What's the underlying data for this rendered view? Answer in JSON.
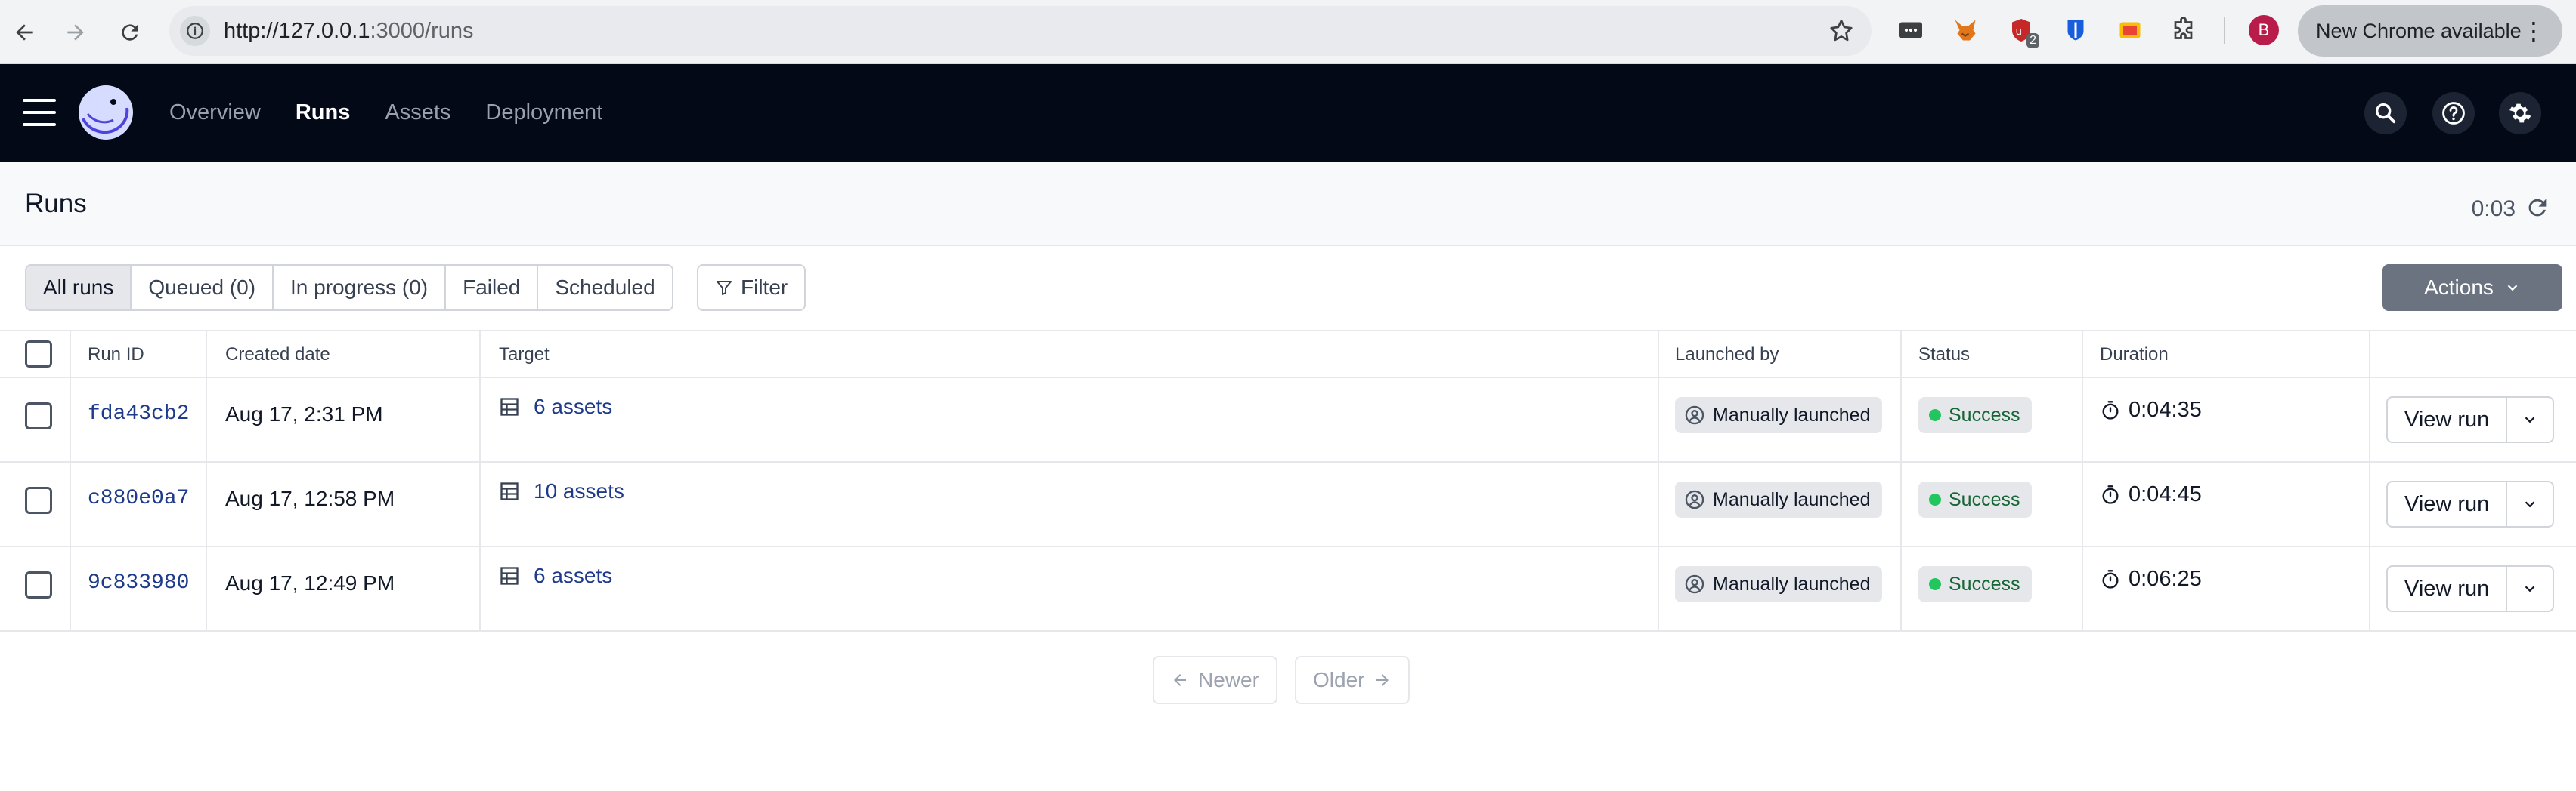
{
  "browser": {
    "url_host": "http://127.0.0.1",
    "url_path": ":3000/runs",
    "profile_initial": "B",
    "extension_badge": "2",
    "update_label": "New Chrome available"
  },
  "appbar": {
    "nav": [
      {
        "label": "Overview"
      },
      {
        "label": "Runs"
      },
      {
        "label": "Assets"
      },
      {
        "label": "Deployment"
      }
    ]
  },
  "page": {
    "title": "Runs",
    "timer": "0:03"
  },
  "toolbar": {
    "tabs": [
      {
        "label": "All runs"
      },
      {
        "label": "Queued (0)"
      },
      {
        "label": "In progress (0)"
      },
      {
        "label": "Failed"
      },
      {
        "label": "Scheduled"
      }
    ],
    "filter_label": "Filter",
    "actions_label": "Actions"
  },
  "table": {
    "columns": {
      "run_id": "Run ID",
      "created": "Created date",
      "target": "Target",
      "launched_by": "Launched by",
      "status": "Status",
      "duration": "Duration"
    },
    "rows": [
      {
        "run_id": "fda43cb2",
        "created": "Aug 17, 2:31 PM",
        "target": "6 assets",
        "launched_by": "Manually launched",
        "status": "Success",
        "duration": "0:04:35",
        "action": "View run"
      },
      {
        "run_id": "c880e0a7",
        "created": "Aug 17, 12:58 PM",
        "target": "10 assets",
        "launched_by": "Manually launched",
        "status": "Success",
        "duration": "0:04:45",
        "action": "View run"
      },
      {
        "run_id": "9c833980",
        "created": "Aug 17, 12:49 PM",
        "target": "6 assets",
        "launched_by": "Manually launched",
        "status": "Success",
        "duration": "0:06:25",
        "action": "View run"
      }
    ]
  },
  "pagination": {
    "newer_label": "Newer",
    "older_label": "Older"
  },
  "colors": {
    "appbar_bg": "#030917",
    "link": "#1e3a8a",
    "success_dot": "#22c55e"
  }
}
